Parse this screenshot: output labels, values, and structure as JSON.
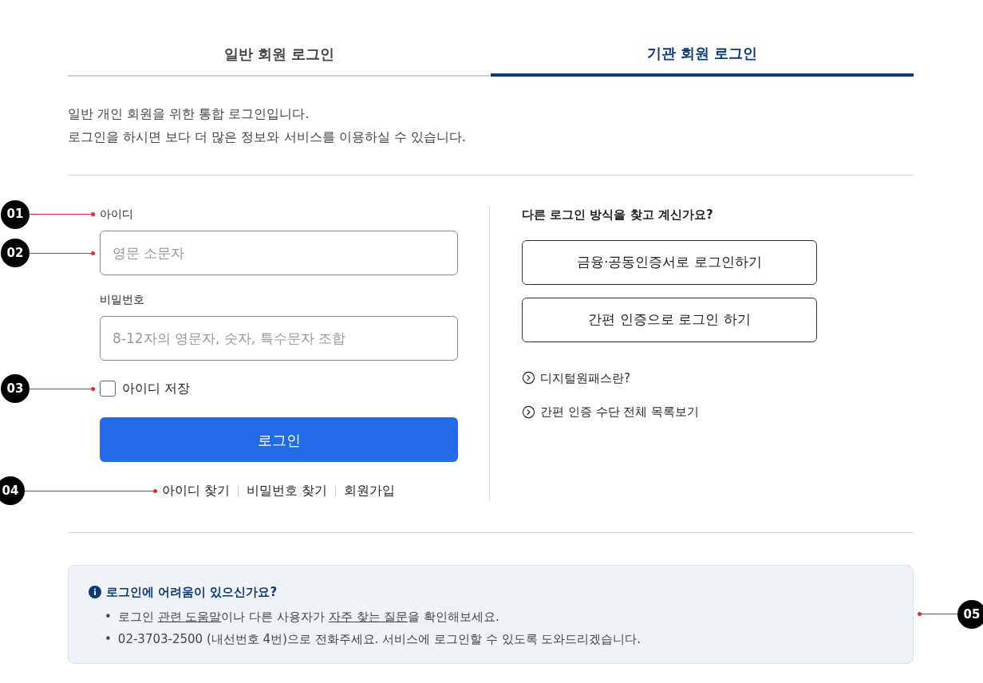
{
  "tabs": [
    {
      "label": "일반 회원 로그인",
      "selected": false
    },
    {
      "label": "기관 회원 로그인",
      "selected": true
    }
  ],
  "intro": [
    "일반 개인 회원을 위한 통합 로그인입니다.",
    "로그인을 하시면 보다 더 많은 정보와 서비스를 이용하실 수 있습니다."
  ],
  "form": {
    "id_label": "아이디",
    "id_placeholder": "영문 소문자",
    "password_label": "비밀번호",
    "password_placeholder": "8-12자의 영문자, 숫자, 특수문자 조합",
    "remember": {
      "label": "아이디 저장",
      "checked": false
    },
    "login_button": "로그인",
    "links": [
      "아이디 찾기",
      "비밀번호 찾기",
      "회원가입"
    ]
  },
  "other": {
    "title": "다른 로그인 방식을 찾고 계신가요?",
    "buttons": [
      "금융·공동인증서로 로그인하기",
      "간편 인증으로 로그인 하기"
    ],
    "links": [
      "디지털원패스란?",
      "간편 인증 수단 전체 목록보기"
    ]
  },
  "help": {
    "title": "로그인에 어려움이 있으신가요?",
    "items": [
      {
        "bullet": "•",
        "parts": [
          {
            "text": "로그인 ",
            "link": false
          },
          {
            "text": "관련 도움말",
            "link": true
          },
          {
            "text": "이나 다른 사용자가 ",
            "link": false
          },
          {
            "text": "자주 찾는 질문",
            "link": true
          },
          {
            "text": "을 확인해보세요.",
            "link": false
          }
        ]
      },
      {
        "bullet": "•",
        "parts": [
          {
            "text": "02-3703-2500 (내선번호 4번)으로 전화주세요. 서비스에 로그인할 수 있도록 도와드리겠습니다.",
            "link": false
          }
        ]
      }
    ]
  },
  "annotations": [
    {
      "label": "01"
    },
    {
      "label": "02"
    },
    {
      "label": "03"
    },
    {
      "label": "04"
    },
    {
      "label": "05"
    }
  ]
}
